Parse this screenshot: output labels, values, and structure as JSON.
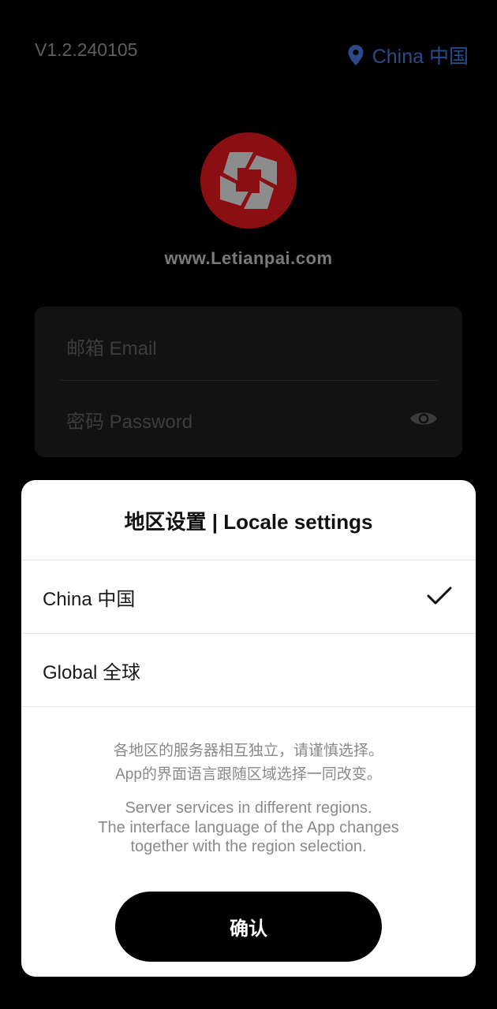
{
  "app": {
    "version": "V1.2.240105",
    "region_label": "China 中国",
    "region_icon": "location-pin-icon",
    "website": "www.Letianpai.com",
    "brand_color": "#8a0f13"
  },
  "login_form": {
    "email_placeholder": "邮箱 Email",
    "password_placeholder": "密码 Password",
    "visibility_icon": "eye-icon"
  },
  "locale_sheet": {
    "title": "地区设置 | Locale settings",
    "options": [
      {
        "label": "China 中国",
        "selected": true
      },
      {
        "label": "Global 全球",
        "selected": false
      }
    ],
    "note_cn": [
      "各地区的服务器相互独立，请谨慎选择。",
      "App的界面语言跟随区域选择一同改变。"
    ],
    "note_en": [
      "Server services in different regions.",
      "The interface language of the App changes",
      "together with the region selection."
    ],
    "confirm_label": "确认",
    "check_icon": "checkmark-icon"
  }
}
